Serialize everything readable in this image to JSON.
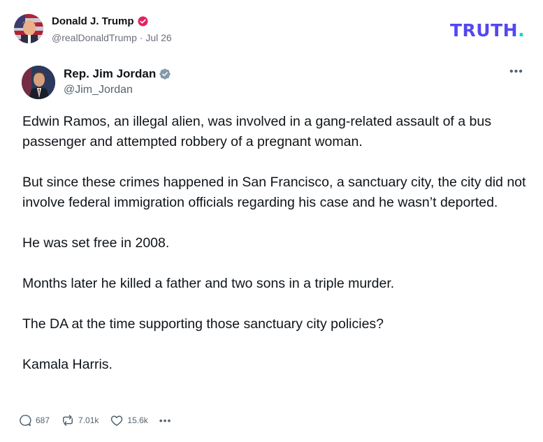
{
  "truth_header": {
    "author_name": "Donald J. Trump",
    "handle": "@realDonaldTrump",
    "separator": "·",
    "date": "Jul 26",
    "logo_text": "TRUTH",
    "logo_dot": "."
  },
  "embedded_post": {
    "author_name": "Rep. Jim Jordan",
    "handle": "@Jim_Jordan",
    "more_label": "•••",
    "paragraphs": [
      "Edwin Ramos, an illegal alien, was involved in a gang-related assault of a bus passenger and attempted robbery of a pregnant woman.",
      "But since these crimes happened in San Francisco, a sanctuary city, the city did not involve federal immigration officials regarding his case and he wasn’t deported.",
      "He was set free in 2008.",
      "Months later he killed a father and two sons in a triple murder.",
      "The DA at the time supporting those sanctuary city policies?",
      "Kamala Harris."
    ],
    "stats": {
      "views": "687",
      "reposts": "7.01k",
      "likes": "15.6k",
      "more": "•••"
    }
  },
  "colors": {
    "truth_brand": "#5448ee",
    "truth_dot": "#17d1c6",
    "truth_verified": "#e0245e",
    "x_verified": "#829aab",
    "muted_text": "#536471"
  },
  "icons": {
    "truth_verified": "verified-badge-icon",
    "x_verified": "verified-check-icon",
    "views": "views-icon",
    "repost": "repost-icon",
    "like": "heart-icon",
    "more": "more-dots-icon"
  }
}
